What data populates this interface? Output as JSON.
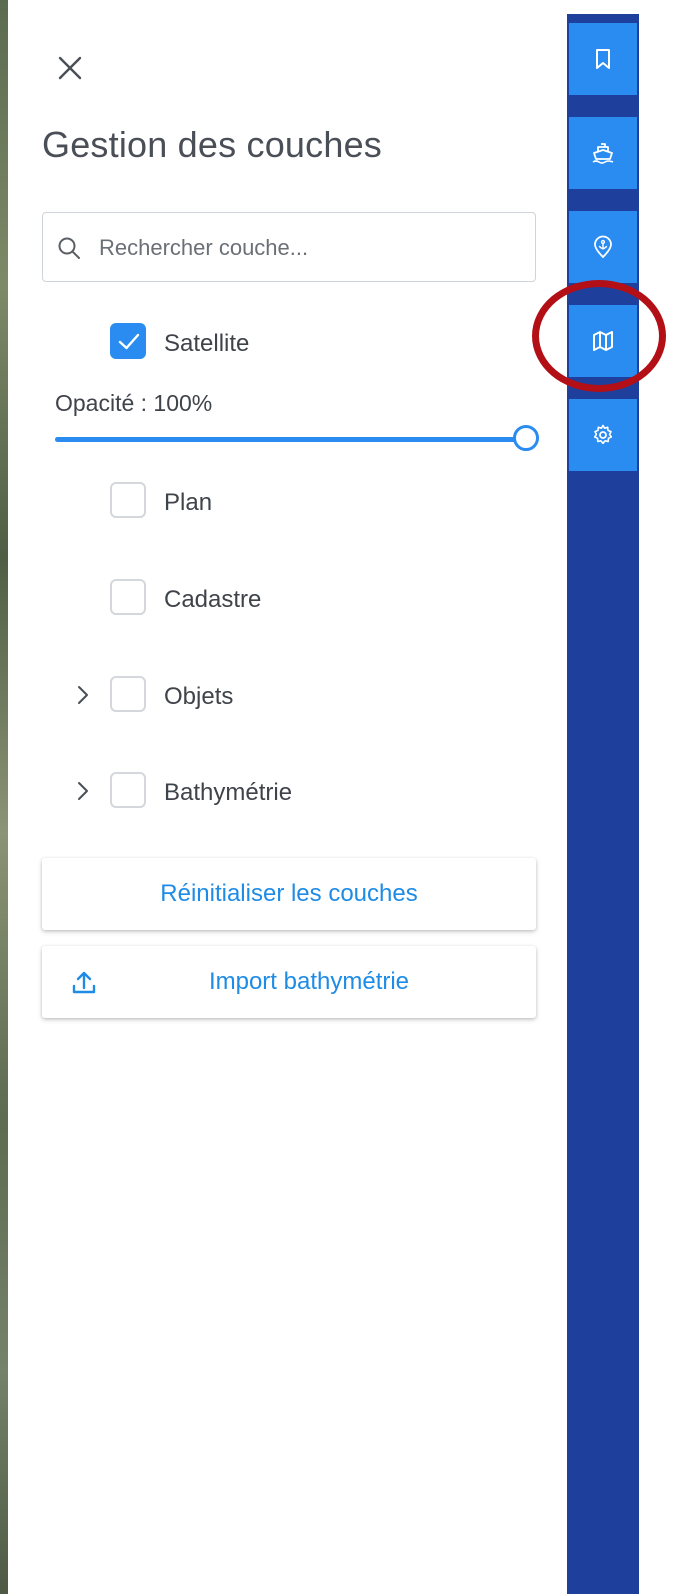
{
  "panel": {
    "title": "Gestion des couches",
    "search": {
      "placeholder": "Rechercher couche...",
      "value": ""
    },
    "layers": [
      {
        "label": "Satellite",
        "checked": true,
        "expandable": false
      },
      {
        "label": "Plan",
        "checked": false,
        "expandable": false
      },
      {
        "label": "Cadastre",
        "checked": false,
        "expandable": false
      },
      {
        "label": "Objets",
        "checked": false,
        "expandable": true
      },
      {
        "label": "Bathymétrie",
        "checked": false,
        "expandable": true
      }
    ],
    "opacity": {
      "label": "Opacité : 100%",
      "value": 1.0
    },
    "reset_button": "Réinitialiser les couches",
    "import_button": "Import bathymétrie"
  },
  "rail": {
    "items": [
      {
        "icon": "bookmark-icon"
      },
      {
        "icon": "ship-icon"
      },
      {
        "icon": "anchor-pin-icon"
      },
      {
        "icon": "map-icon",
        "highlighted": true
      },
      {
        "icon": "gear-icon"
      }
    ]
  },
  "colors": {
    "accent": "#2a8cf0",
    "rail_background": "#1f3f9c",
    "link_text": "#1e8ce6",
    "highlight_ring": "#b30f16",
    "title_text": "#4a4f57"
  }
}
